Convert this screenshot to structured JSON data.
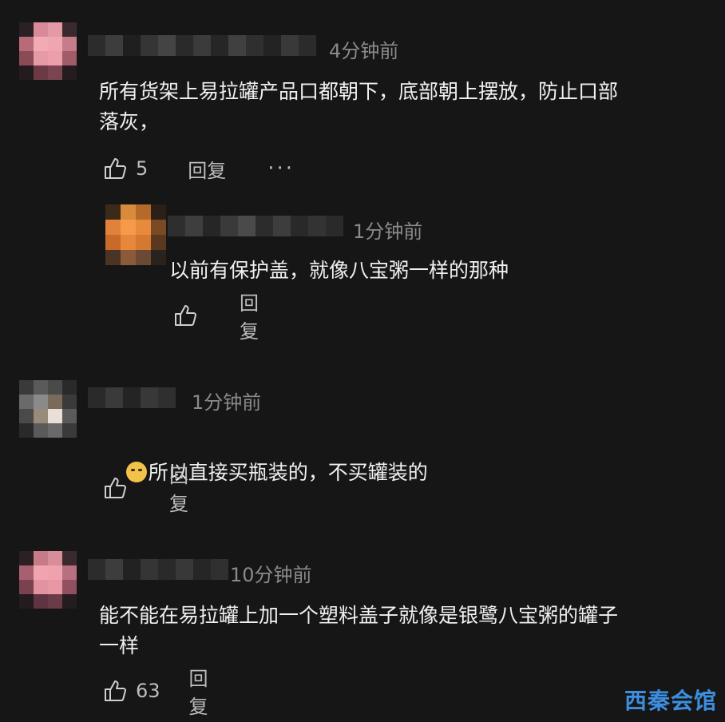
{
  "comments": [
    {
      "time": "4分钟前",
      "text": "所有货架上易拉罐产品口都朝下，底部朝上摆放，防止口部\n落灰，",
      "likes": "5",
      "reply_label": "回复",
      "more_label": "···",
      "reply": {
        "time": "1分钟前",
        "text": "以前有保护盖，就像八宝粥一样的那种",
        "reply_label": "回复"
      }
    },
    {
      "time": "1分钟前",
      "text": "所以直接买瓶装的，不买罐装的",
      "reply_label": "回复"
    },
    {
      "time": "10分钟前",
      "text": "能不能在易拉罐上加一个塑料盖子就像是银鹭八宝粥的罐子\n一样",
      "likes": "63",
      "reply_label": "回复"
    }
  ],
  "watermark": "西秦会馆",
  "icons": {
    "like": "thumbs-up-icon",
    "emoji": "cat-face-emoji-icon"
  },
  "colors": {
    "background": "#161616",
    "text": "#f0f0f0",
    "muted": "#8a8a8a",
    "watermark": "#3c8fe0"
  }
}
